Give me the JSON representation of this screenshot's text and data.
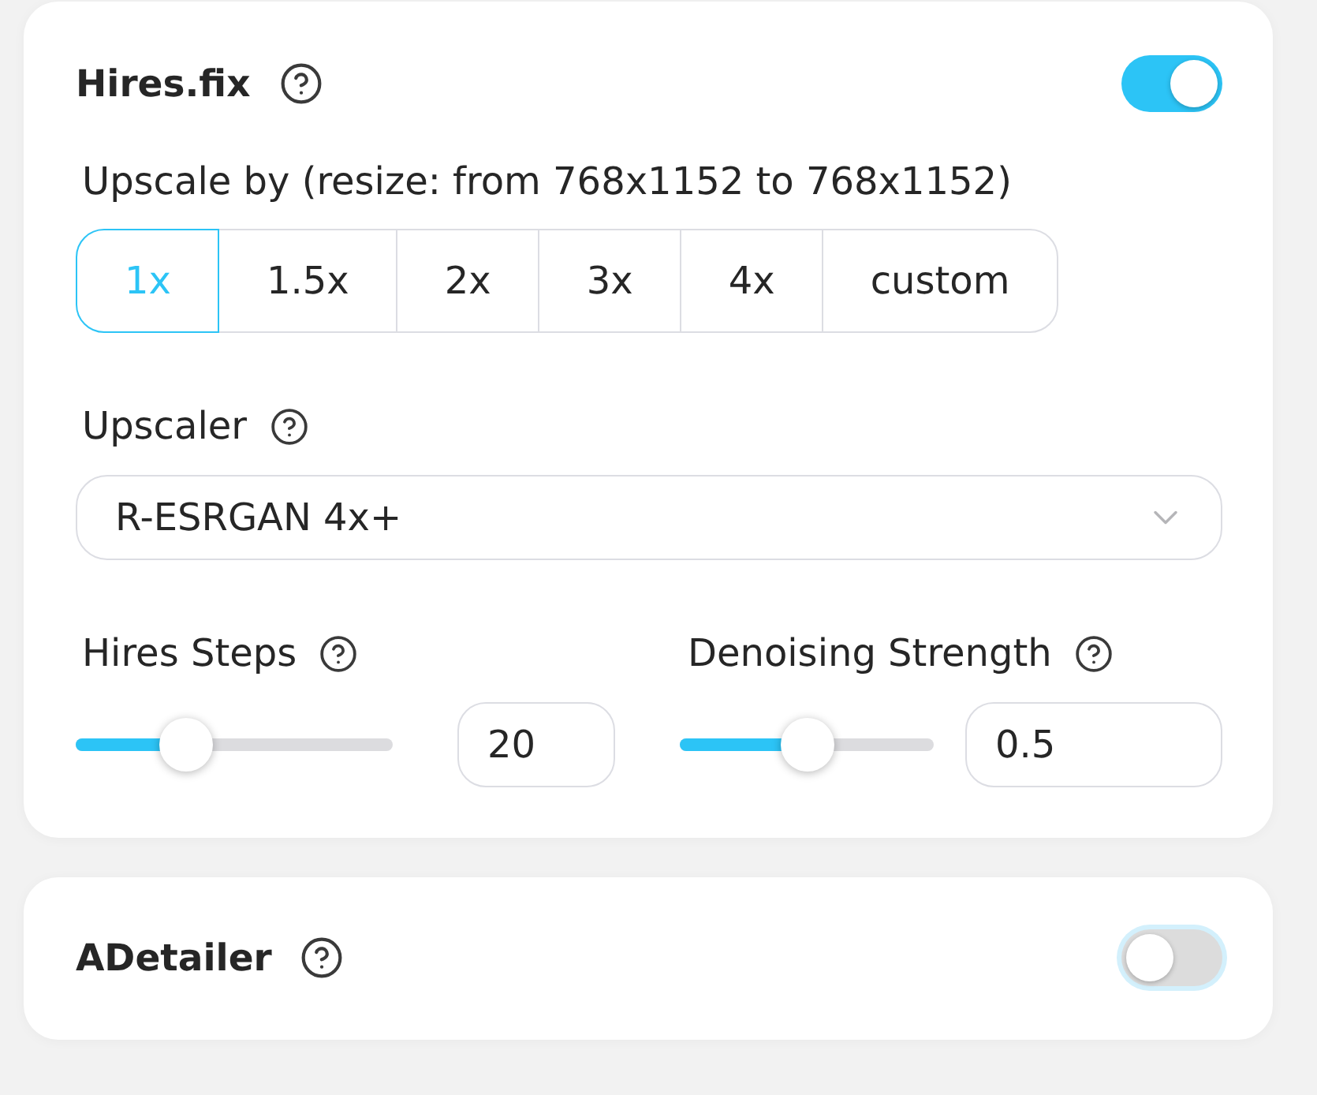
{
  "hires_fix": {
    "title": "Hires.fix",
    "on": true,
    "upscale_by": {
      "label": "Upscale by (resize: from 768x1152 to 768x1152)",
      "options": [
        {
          "label": "1x",
          "selected": true
        },
        {
          "label": "1.5x",
          "selected": false
        },
        {
          "label": "2x",
          "selected": false
        },
        {
          "label": "3x",
          "selected": false
        },
        {
          "label": "4x",
          "selected": false
        },
        {
          "label": "custom",
          "selected": false
        }
      ]
    },
    "upscaler": {
      "label": "Upscaler",
      "value": "R-ESRGAN 4x+"
    },
    "params": [
      {
        "label": "Hires Steps",
        "level": 0.35,
        "value": "20"
      },
      {
        "label": "Denoising Strength",
        "level": 0.5,
        "value": "0.5"
      }
    ]
  },
  "adetailer": {
    "title": "ADetailer",
    "on": false,
    "focused": true
  }
}
